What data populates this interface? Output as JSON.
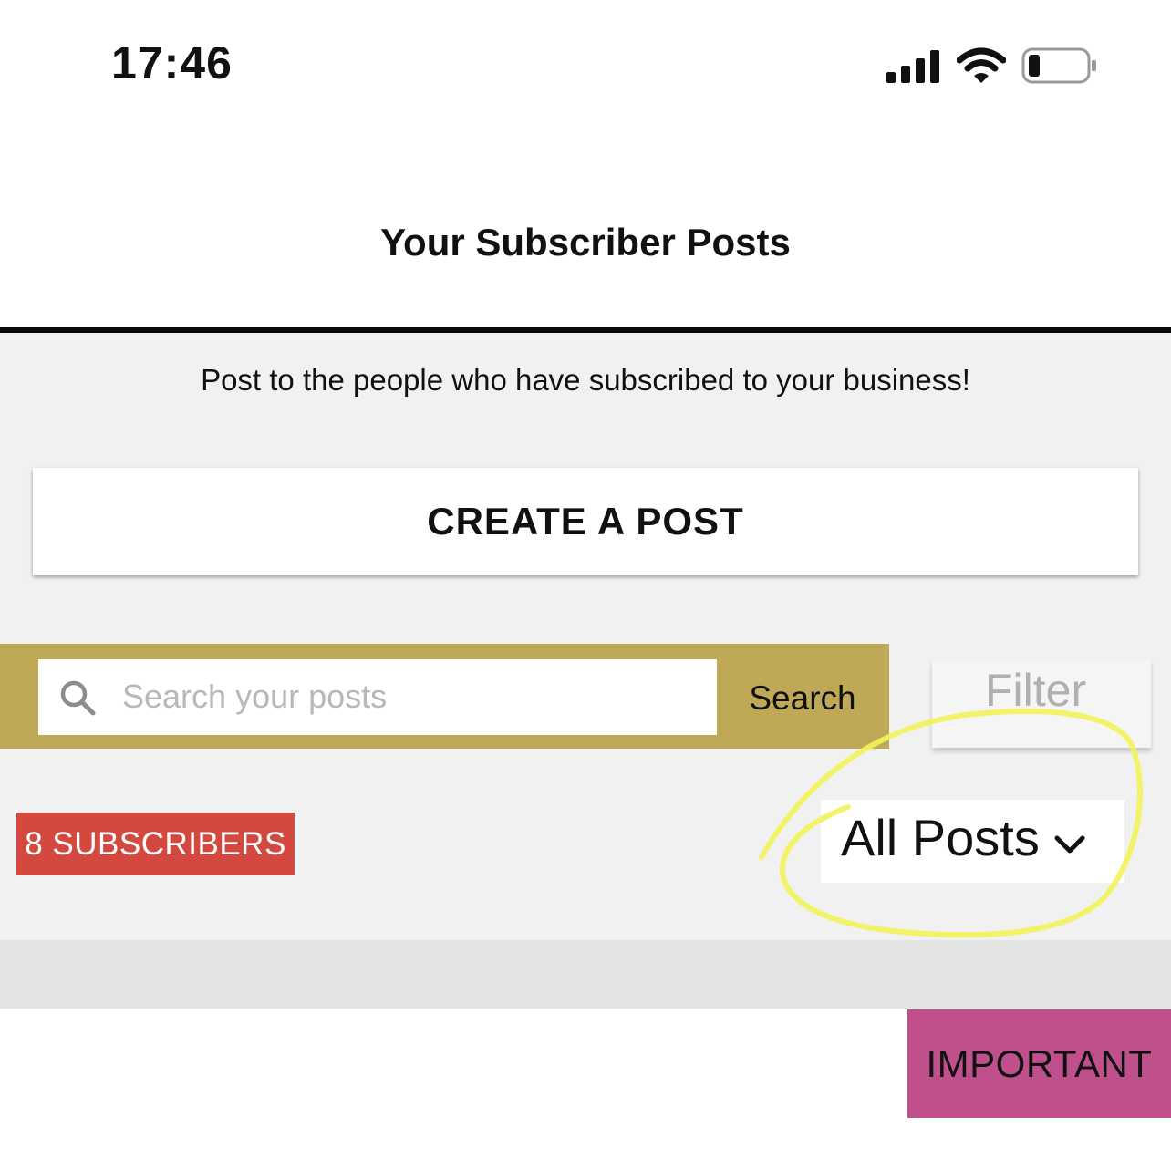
{
  "status_bar": {
    "time": "17:46",
    "icons": [
      "cellular-signal-icon",
      "wifi-icon",
      "battery-icon"
    ]
  },
  "header": {
    "title": "Your Subscriber Posts"
  },
  "main": {
    "subtitle": "Post to the people who have subscribed to your business!",
    "create_button": "CREATE A POST",
    "search": {
      "placeholder": "Search your posts",
      "value": "",
      "button_label": "Search",
      "icon": "search-icon"
    },
    "filter_label": "Filter",
    "subscribers_badge": "8 SUBSCRIBERS",
    "posts_filter": {
      "selected": "All Posts",
      "icon": "chevron-down-icon"
    },
    "important_button": "IMPORTANT"
  },
  "colors": {
    "search_bar": "#c0a956",
    "subscribers_badge": "#d3493f",
    "important_button": "#c0508c",
    "highlight_annotation": "#f3f35a",
    "page_background": "#f1f1f1"
  }
}
